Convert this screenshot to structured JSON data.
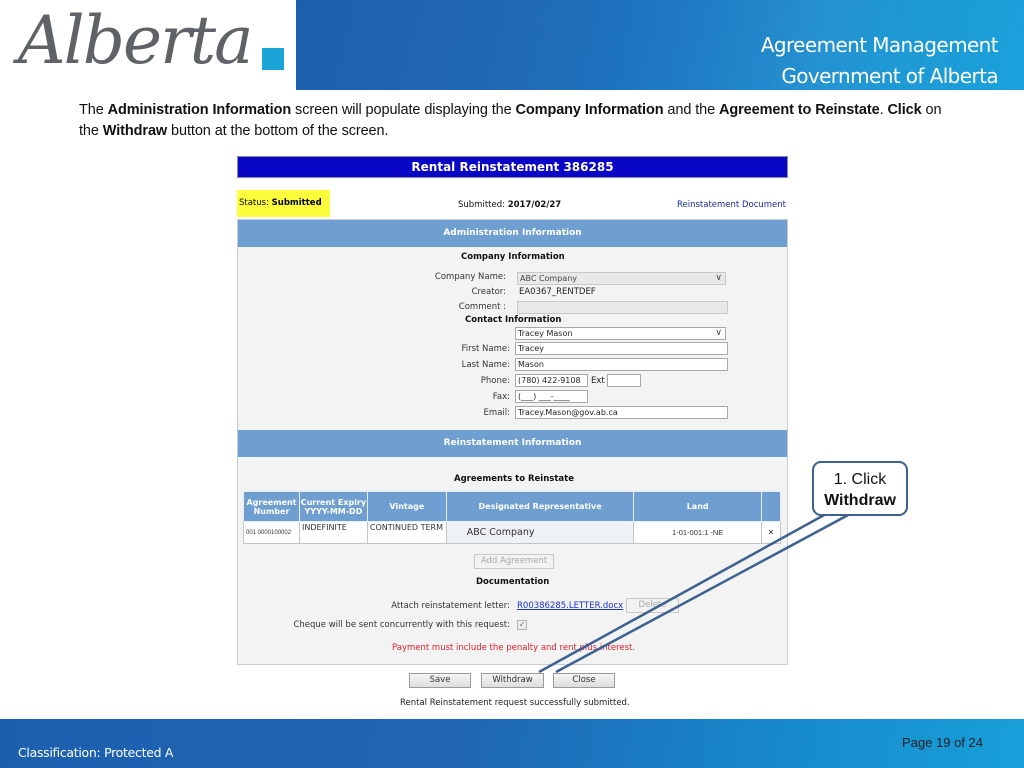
{
  "header": {
    "logo_text": "Alberta",
    "title_line1": "Agreement Management",
    "title_line2": "Government of Alberta",
    "accent_color": "#1ba4d8"
  },
  "instruction": {
    "p1": "The ",
    "b1": "Administration Information",
    "p2": " screen will populate displaying the ",
    "b2": "Company Information",
    "p3": " and the ",
    "b3": "Agreement to Reinstate",
    "p4": ".  ",
    "b4": "Click",
    "p5": " on the ",
    "b5": "Withdraw",
    "p6": " button at the bottom of the screen."
  },
  "app": {
    "title": "Rental Reinstatement 386285",
    "status_label": "Status: ",
    "status_value": "Submitted",
    "submitted_label": "Submitted: ",
    "submitted_value": "2017/02/27",
    "reinstatement_document_link": "Reinstatement Document",
    "admin_section_title": "Administration Information",
    "company_info_heading": "Company Information",
    "company_name_label": "Company Name:",
    "company_name_value": "ABC Company",
    "creator_label": "Creator:",
    "creator_value": "EA0367_RENTDEF",
    "comment_label": "Comment :",
    "comment_value": "",
    "contact_info_heading": "Contact Information",
    "contact_select_value": "Tracey Mason",
    "first_name_label": "First Name:",
    "first_name_value": "Tracey",
    "last_name_label": "Last Name:",
    "last_name_value": "Mason",
    "phone_label": "Phone:",
    "phone_value": "(780) 422-9108",
    "ext_label": "Ext",
    "ext_value": "",
    "fax_label": "Fax:",
    "fax_value": "(___) ___-____",
    "email_label": "Email:",
    "email_value": "Tracey.Mason@gov.ab.ca",
    "reinstatement_section_title": "Reinstatement Information",
    "agreements_heading": "Agreements to Reinstate",
    "table": {
      "headers": [
        "Agreement Number",
        "Current Expiry YYYY-MM-DD",
        "Vintage",
        "Designated Representative",
        "Land",
        ""
      ],
      "rows": [
        {
          "agreement_number": "001 0000100002",
          "expiry": "INDEFINITE",
          "vintage": "CONTINUED TERM",
          "representative": "ABC Company",
          "land": "1-01-001:1 -NE"
        }
      ]
    },
    "add_agreement_button": "Add Agreement",
    "documentation_heading": "Documentation",
    "attach_letter_label": "Attach reinstatement letter:",
    "attach_letter_link": "R00386285.LETTER.docx",
    "delete_button": "Delete",
    "cheque_label": "Cheque will be sent concurrently with this request:",
    "cheque_checked": true,
    "payment_warning": "Payment must include the penalty and rent plus interest.",
    "save_button": "Save",
    "withdraw_button": "Withdraw",
    "close_button": "Close",
    "success_message": "Rental Reinstatement request successfully submitted."
  },
  "callout": {
    "line1": "1. Click",
    "line2": "Withdraw"
  },
  "footer": {
    "classification": "Classification: Protected A",
    "page": "Page 19 of 24"
  }
}
